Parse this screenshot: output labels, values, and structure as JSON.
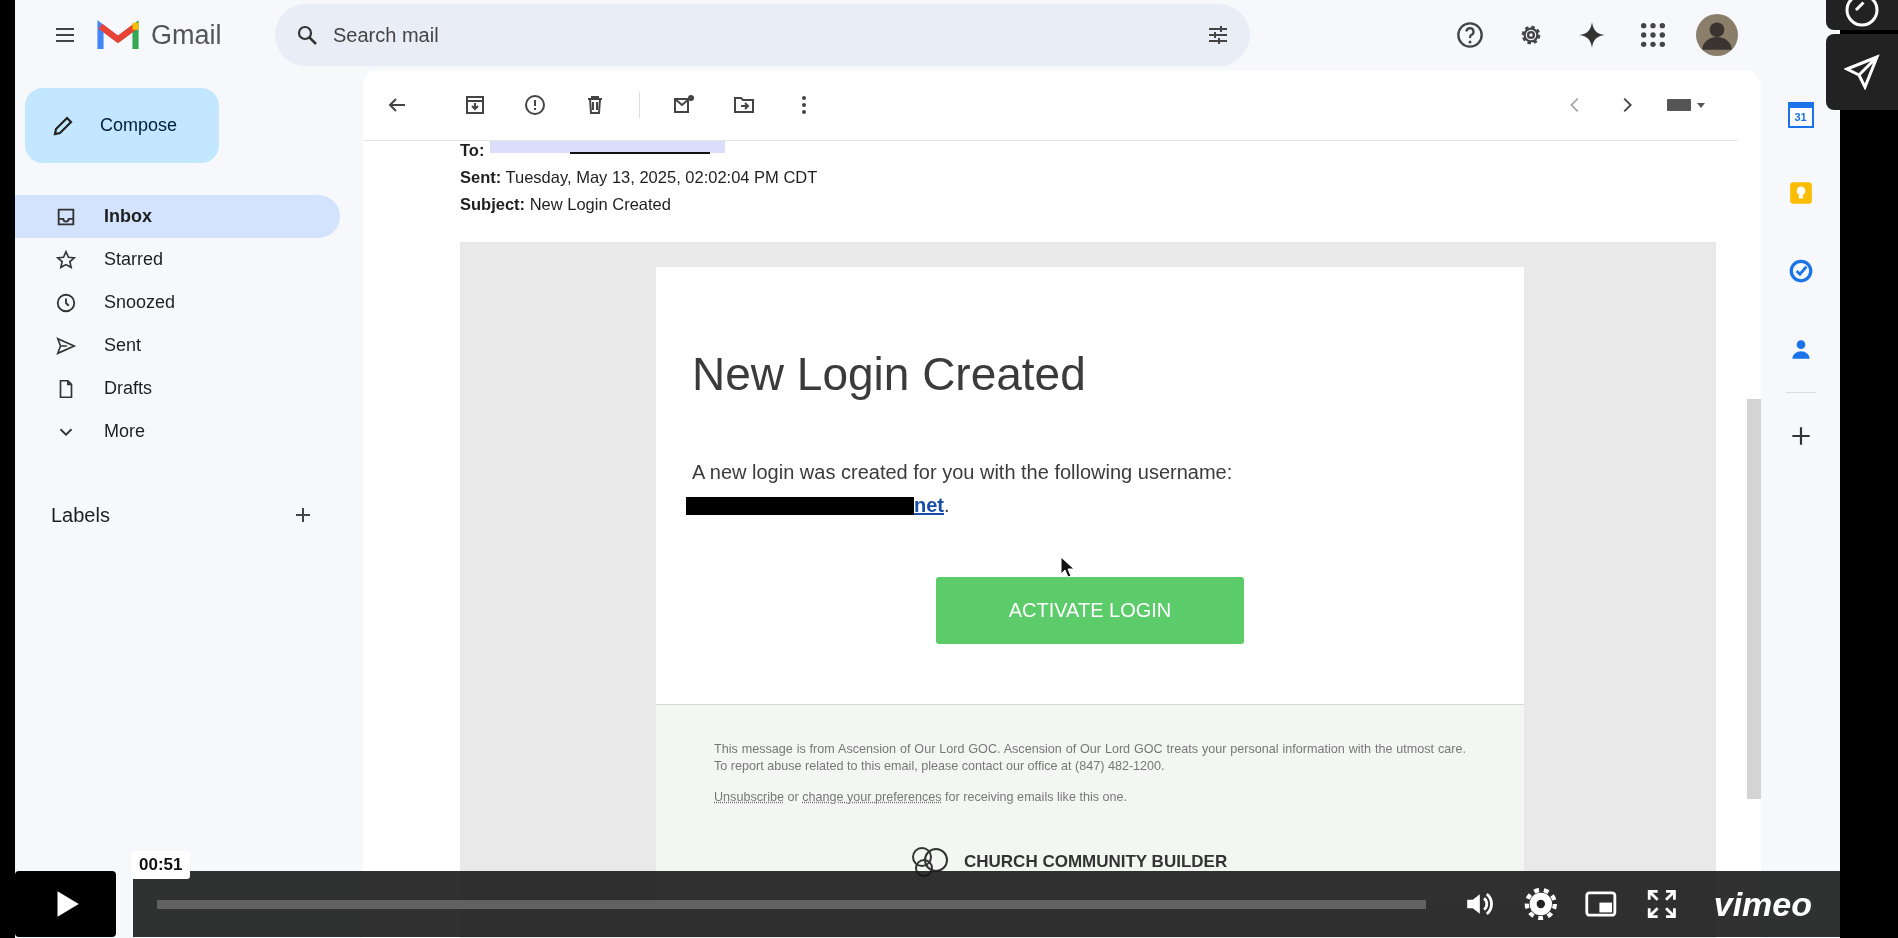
{
  "gmail": {
    "product_name": "Gmail",
    "search": {
      "placeholder": "Search mail"
    },
    "compose": "Compose",
    "nav": [
      {
        "label": "Inbox",
        "selected": true
      },
      {
        "label": "Starred",
        "selected": false
      },
      {
        "label": "Snoozed",
        "selected": false
      },
      {
        "label": "Sent",
        "selected": false
      },
      {
        "label": "Drafts",
        "selected": false
      },
      {
        "label": "More",
        "selected": false
      }
    ],
    "labels_heading": "Labels"
  },
  "email": {
    "header": [
      {
        "label": "To:"
      },
      {
        "label": "Sent:",
        "value": "Tuesday, May 13, 2025, 02:02:04 PM CDT"
      },
      {
        "label": "Subject:",
        "value": "New Login Created"
      }
    ],
    "title": "New Login Created",
    "intro": "A new login was created for you with the following username:",
    "username_link": "net",
    "username_end": ".",
    "button": "ACTIVATE LOGIN",
    "footer_notice": "This message is from Ascension of Our Lord GOC. Ascension of Our Lord GOC treats your personal information with the utmost care. To report abuse related to this email, please contact our office at (847) 482-1200.",
    "unsubscribe_link": "Unsubscribe",
    "or": "or",
    "preferences_link": "change your preferences",
    "preferences_rest": "for receiving emails like this one.",
    "brand": "CHURCH COMMUNITY BUILDER"
  },
  "side_panel": {
    "calendar_day": "31"
  },
  "player": {
    "time": "00:51",
    "logo": "vimeo"
  }
}
